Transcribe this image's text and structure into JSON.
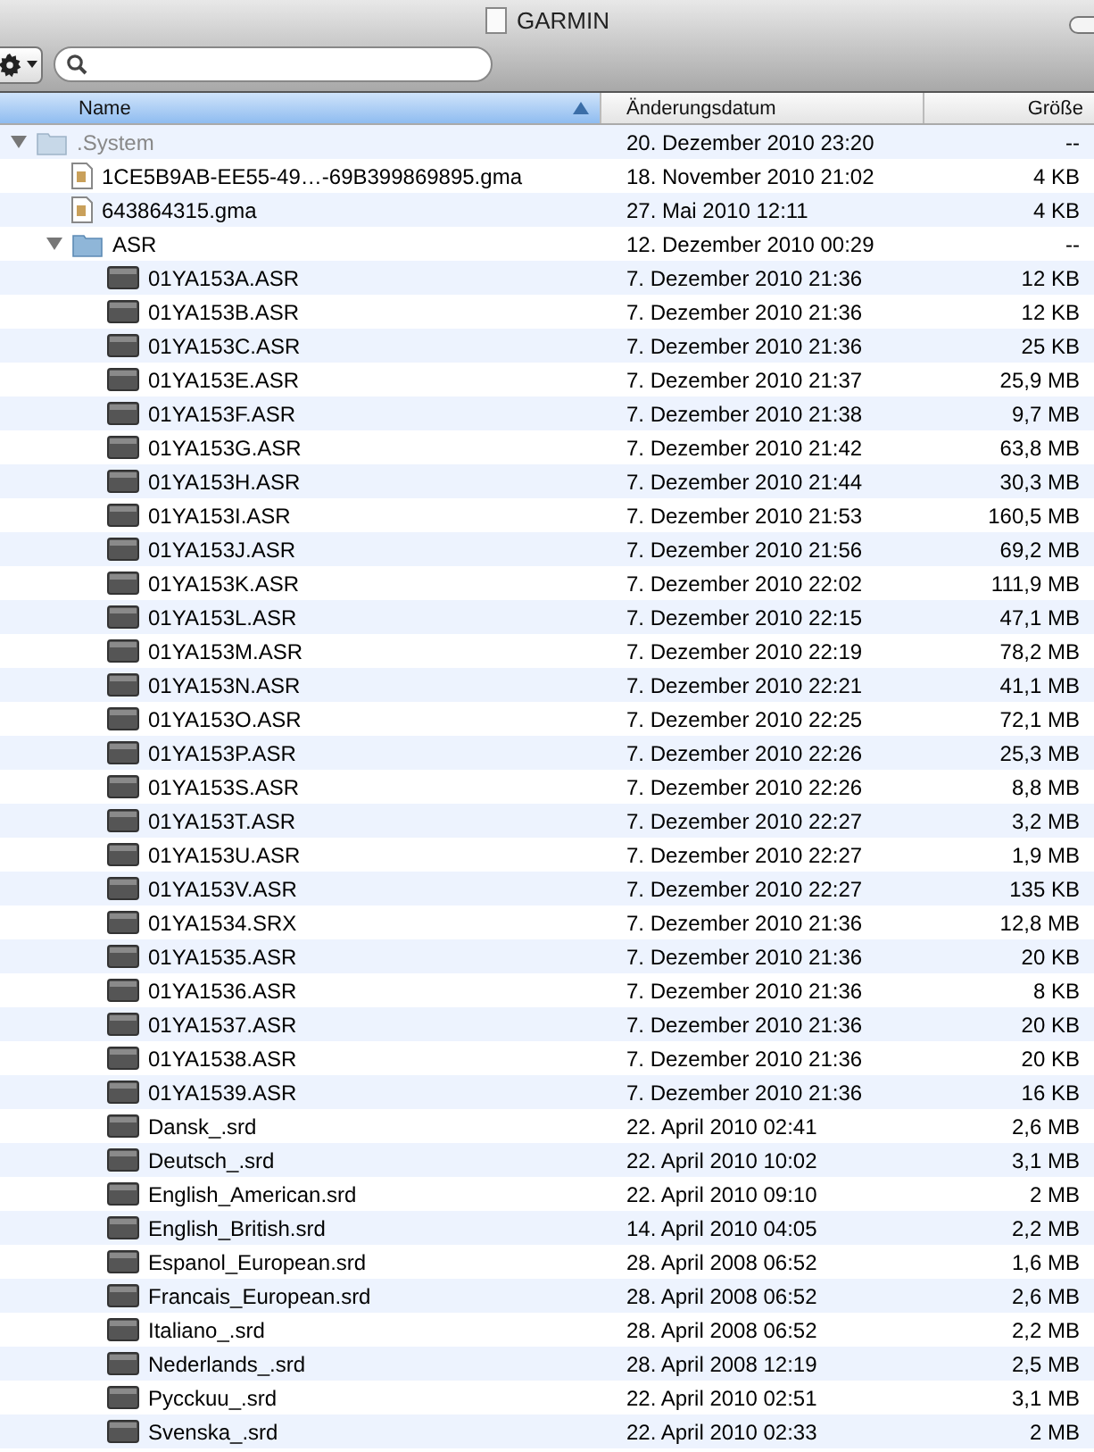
{
  "window": {
    "title": "GARMIN"
  },
  "columns": [
    {
      "label": "Name",
      "selected": true,
      "sort_ascending": true
    },
    {
      "label": "Änderungsdatum",
      "selected": false
    },
    {
      "label": "Größe",
      "selected": false
    }
  ],
  "items": [
    {
      "kind": "folder",
      "name": ".System",
      "date": "20. Dezember 2010 23:20",
      "size": "--",
      "dimmed": true,
      "expanded": true,
      "children": [
        {
          "kind": "document",
          "name": "1CE5B9AB-EE55-49…-69B399869895.gma",
          "date": "18. November 2010 21:02",
          "size": "4 KB",
          "dimmed": false
        },
        {
          "kind": "document",
          "name": "643864315.gma",
          "date": "27. Mai 2010 12:11",
          "size": "4 KB",
          "dimmed": false
        },
        {
          "kind": "folder",
          "name": "ASR",
          "date": "12. Dezember 2010 00:29",
          "size": "--",
          "dimmed": false,
          "expanded": true,
          "children": [
            {
              "kind": "file",
              "name": "01YA153A.ASR",
              "date": "7. Dezember 2010 21:36",
              "size": "12 KB",
              "dimmed": false
            },
            {
              "kind": "file",
              "name": "01YA153B.ASR",
              "date": "7. Dezember 2010 21:36",
              "size": "12 KB",
              "dimmed": false
            },
            {
              "kind": "file",
              "name": "01YA153C.ASR",
              "date": "7. Dezember 2010 21:36",
              "size": "25 KB",
              "dimmed": false
            },
            {
              "kind": "file",
              "name": "01YA153E.ASR",
              "date": "7. Dezember 2010 21:37",
              "size": "25,9 MB",
              "dimmed": false
            },
            {
              "kind": "file",
              "name": "01YA153F.ASR",
              "date": "7. Dezember 2010 21:38",
              "size": "9,7 MB",
              "dimmed": false
            },
            {
              "kind": "file",
              "name": "01YA153G.ASR",
              "date": "7. Dezember 2010 21:42",
              "size": "63,8 MB",
              "dimmed": false
            },
            {
              "kind": "file",
              "name": "01YA153H.ASR",
              "date": "7. Dezember 2010 21:44",
              "size": "30,3 MB",
              "dimmed": false
            },
            {
              "kind": "file",
              "name": "01YA153I.ASR",
              "date": "7. Dezember 2010 21:53",
              "size": "160,5 MB",
              "dimmed": false
            },
            {
              "kind": "file",
              "name": "01YA153J.ASR",
              "date": "7. Dezember 2010 21:56",
              "size": "69,2 MB",
              "dimmed": false
            },
            {
              "kind": "file",
              "name": "01YA153K.ASR",
              "date": "7. Dezember 2010 22:02",
              "size": "111,9 MB",
              "dimmed": false
            },
            {
              "kind": "file",
              "name": "01YA153L.ASR",
              "date": "7. Dezember 2010 22:15",
              "size": "47,1 MB",
              "dimmed": false
            },
            {
              "kind": "file",
              "name": "01YA153M.ASR",
              "date": "7. Dezember 2010 22:19",
              "size": "78,2 MB",
              "dimmed": false
            },
            {
              "kind": "file",
              "name": "01YA153N.ASR",
              "date": "7. Dezember 2010 22:21",
              "size": "41,1 MB",
              "dimmed": false
            },
            {
              "kind": "file",
              "name": "01YA153O.ASR",
              "date": "7. Dezember 2010 22:25",
              "size": "72,1 MB",
              "dimmed": false
            },
            {
              "kind": "file",
              "name": "01YA153P.ASR",
              "date": "7. Dezember 2010 22:26",
              "size": "25,3 MB",
              "dimmed": false
            },
            {
              "kind": "file",
              "name": "01YA153S.ASR",
              "date": "7. Dezember 2010 22:26",
              "size": "8,8 MB",
              "dimmed": false
            },
            {
              "kind": "file",
              "name": "01YA153T.ASR",
              "date": "7. Dezember 2010 22:27",
              "size": "3,2 MB",
              "dimmed": false
            },
            {
              "kind": "file",
              "name": "01YA153U.ASR",
              "date": "7. Dezember 2010 22:27",
              "size": "1,9 MB",
              "dimmed": false
            },
            {
              "kind": "file",
              "name": "01YA153V.ASR",
              "date": "7. Dezember 2010 22:27",
              "size": "135 KB",
              "dimmed": false
            },
            {
              "kind": "file",
              "name": "01YA1534.SRX",
              "date": "7. Dezember 2010 21:36",
              "size": "12,8 MB",
              "dimmed": false
            },
            {
              "kind": "file",
              "name": "01YA1535.ASR",
              "date": "7. Dezember 2010 21:36",
              "size": "20 KB",
              "dimmed": false
            },
            {
              "kind": "file",
              "name": "01YA1536.ASR",
              "date": "7. Dezember 2010 21:36",
              "size": "8 KB",
              "dimmed": false
            },
            {
              "kind": "file",
              "name": "01YA1537.ASR",
              "date": "7. Dezember 2010 21:36",
              "size": "20 KB",
              "dimmed": false
            },
            {
              "kind": "file",
              "name": "01YA1538.ASR",
              "date": "7. Dezember 2010 21:36",
              "size": "20 KB",
              "dimmed": false
            },
            {
              "kind": "file",
              "name": "01YA1539.ASR",
              "date": "7. Dezember 2010 21:36",
              "size": "16 KB",
              "dimmed": false
            },
            {
              "kind": "file",
              "name": "Dansk_.srd",
              "date": "22. April 2010 02:41",
              "size": "2,6 MB",
              "dimmed": false
            },
            {
              "kind": "file",
              "name": "Deutsch_.srd",
              "date": "22. April 2010 10:02",
              "size": "3,1 MB",
              "dimmed": false
            },
            {
              "kind": "file",
              "name": "English_American.srd",
              "date": "22. April 2010 09:10",
              "size": "2 MB",
              "dimmed": false
            },
            {
              "kind": "file",
              "name": "English_British.srd",
              "date": "14. April 2010 04:05",
              "size": "2,2 MB",
              "dimmed": false
            },
            {
              "kind": "file",
              "name": "Espanol_European.srd",
              "date": "28. April 2008 06:52",
              "size": "1,6 MB",
              "dimmed": false
            },
            {
              "kind": "file",
              "name": "Francais_European.srd",
              "date": "28. April 2008 06:52",
              "size": "2,6 MB",
              "dimmed": false
            },
            {
              "kind": "file",
              "name": "Italiano_.srd",
              "date": "28. April 2008 06:52",
              "size": "2,2 MB",
              "dimmed": false
            },
            {
              "kind": "file",
              "name": "Nederlands_.srd",
              "date": "28. April 2008 12:19",
              "size": "2,5 MB",
              "dimmed": false
            },
            {
              "kind": "file",
              "name": "Pycckuu_.srd",
              "date": "22. April 2010 02:51",
              "size": "3,1 MB",
              "dimmed": false
            },
            {
              "kind": "file",
              "name": "Svenska_.srd",
              "date": "22. April 2010 02:33",
              "size": "2 MB",
              "dimmed": false
            }
          ]
        }
      ]
    }
  ]
}
